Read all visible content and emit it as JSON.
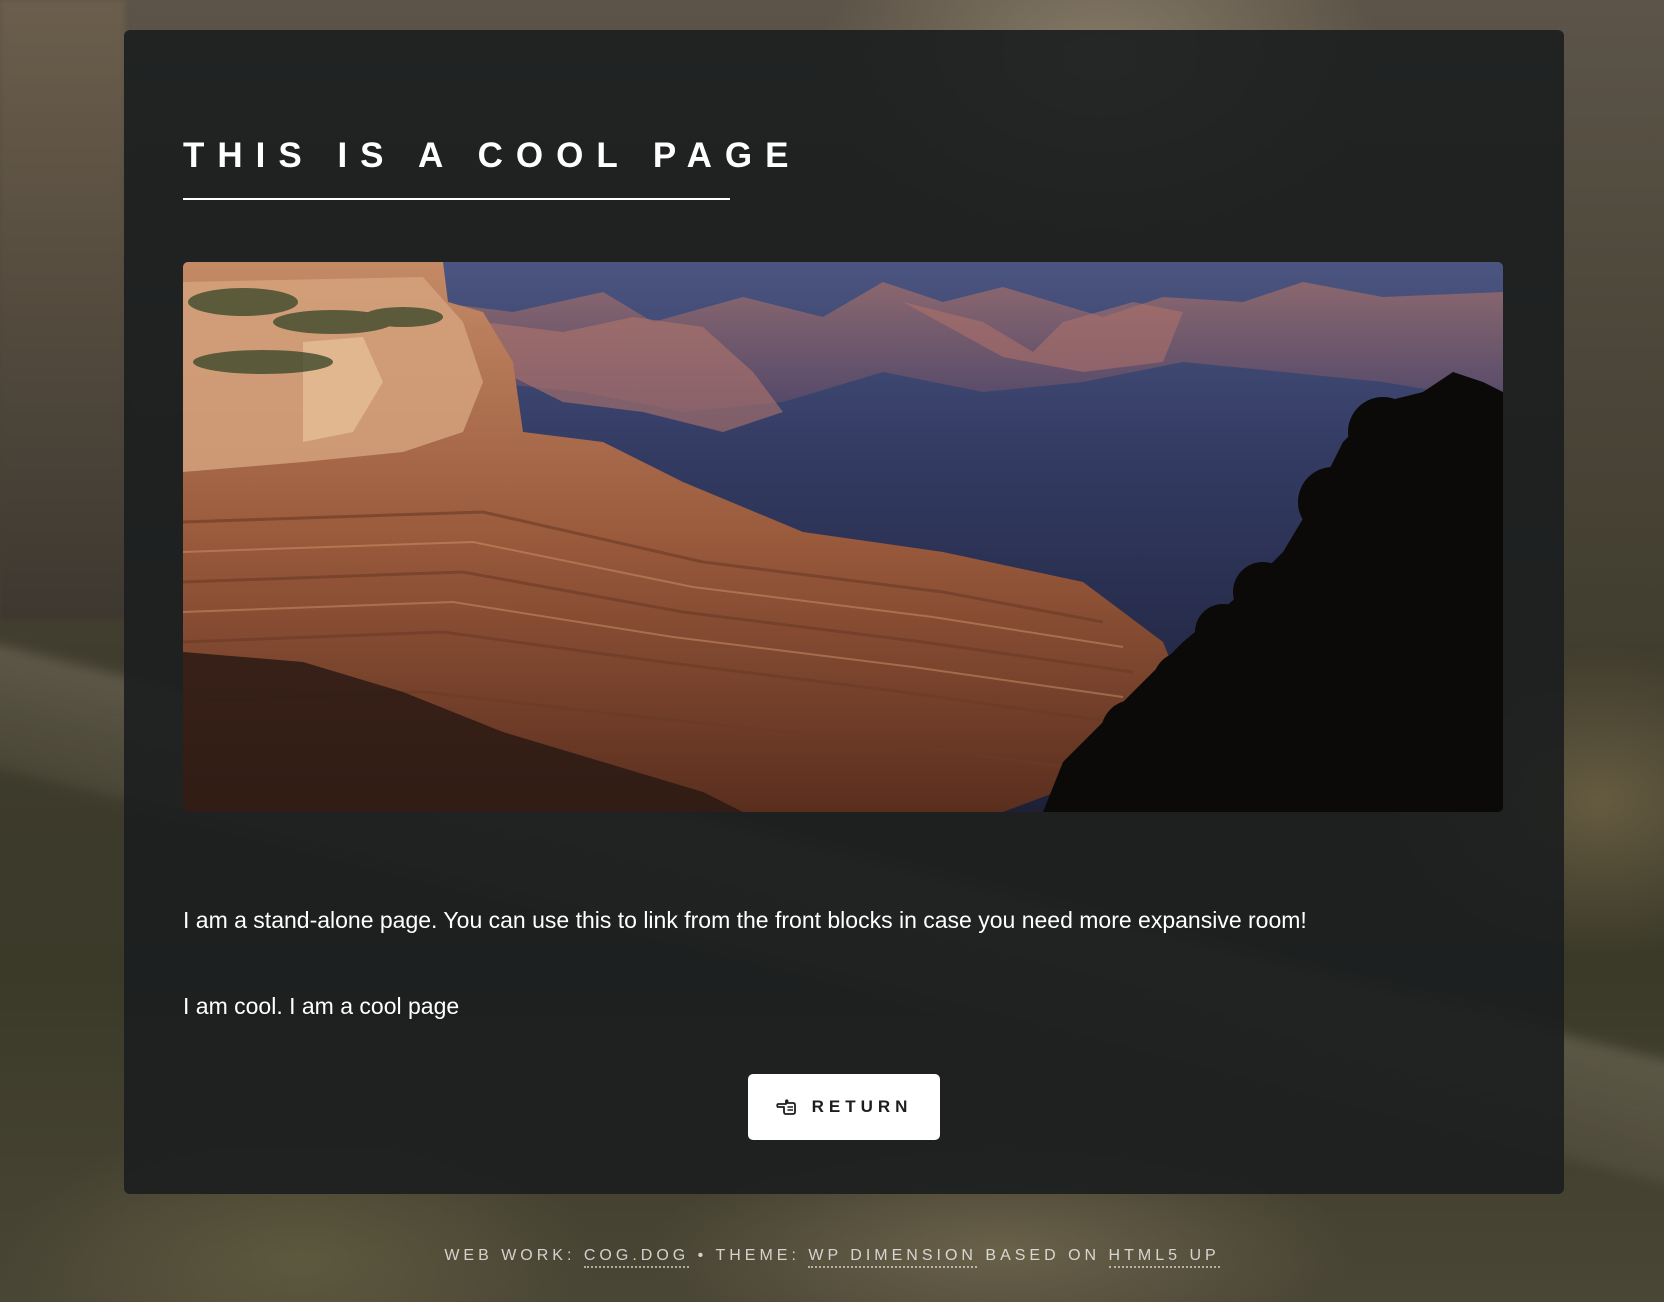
{
  "page": {
    "title": "THIS IS A COOL PAGE",
    "paragraphs": [
      "I am a stand-alone page. You can use this to link from the front blocks in case you need more expansive room!",
      "I am cool. I am a cool page"
    ],
    "image": {
      "subject": "canyon landscape photo"
    },
    "return_button": {
      "label": "RETURN",
      "icon": "pointing-hand-left-icon"
    }
  },
  "footer": {
    "web_work_prefix": "WEB WORK:",
    "web_work_link": "COG.DOG",
    "separator": "•",
    "theme_prefix": "THEME:",
    "theme_link": "WP DIMENSION",
    "based_on_text": "BASED ON",
    "based_on_link": "HTML5 UP"
  },
  "colors": {
    "panel_bg": "#1b1e1f",
    "text": "#ffffff",
    "button_bg": "#ffffff",
    "button_text": "#1b1e1f"
  }
}
